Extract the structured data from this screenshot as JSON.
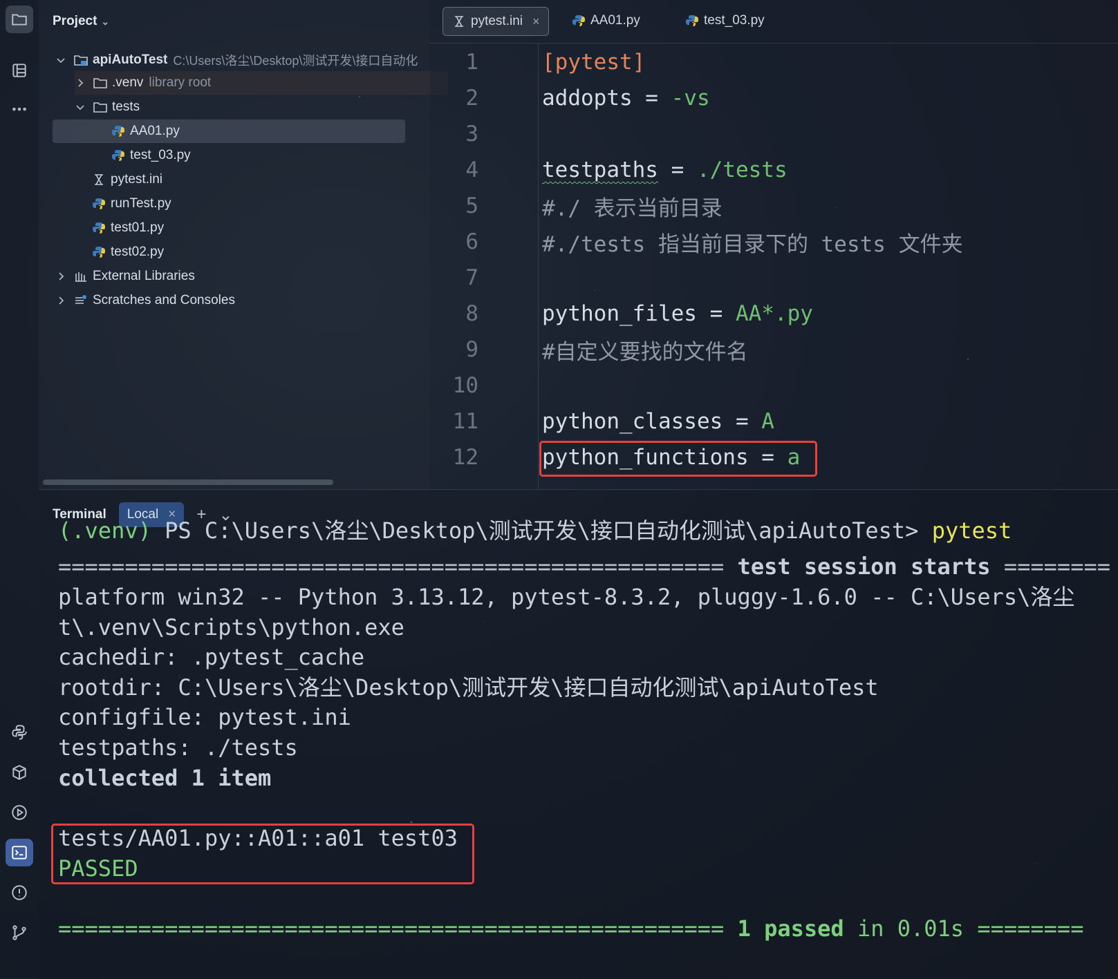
{
  "toolbar": {
    "items": [
      {
        "name": "folder-icon"
      },
      {
        "name": "structure-icon"
      },
      {
        "name": "more-icon"
      },
      {
        "name": "python-console-icon"
      },
      {
        "name": "python-packages-icon"
      },
      {
        "name": "run-icon"
      },
      {
        "name": "terminal-icon"
      },
      {
        "name": "problems-icon"
      },
      {
        "name": "git-icon"
      }
    ]
  },
  "project": {
    "title": "Project",
    "root": {
      "label": "apiAutoTest",
      "path": "C:\\Users\\洛尘\\Desktop\\测试开发\\接口自动化"
    },
    "venv": {
      "label": ".venv",
      "note": "library root"
    },
    "tests_folder": "tests",
    "test_files": [
      "AA01.py",
      "test_03.py"
    ],
    "root_files": [
      "pytest.ini",
      "runTest.py",
      "test01.py",
      "test02.py"
    ],
    "external": "External Libraries",
    "scratches": "Scratches and Consoles"
  },
  "editor": {
    "tabs": [
      {
        "label": "pytest.ini",
        "active": true,
        "close": "×"
      },
      {
        "label": "AA01.py"
      },
      {
        "label": "test_03.py"
      }
    ],
    "line_numbers": [
      "1",
      "2",
      "3",
      "4",
      "5",
      "6",
      "7",
      "8",
      "9",
      "10",
      "11",
      "12"
    ],
    "lines": {
      "l1": "[pytest]",
      "l2_key": "addopts = ",
      "l2_val": "-vs",
      "l4_key": "testpaths",
      "l4_eq": " = ",
      "l4_val": "./tests",
      "l5": "#./ 表示当前目录",
      "l6": "#./tests 指当前目录下的 tests 文件夹",
      "l8_key": "python_files = ",
      "l8_val": "AA*.py",
      "l9": "#自定义要找的文件名",
      "l11_key": "python_classes = ",
      "l11_val": "A",
      "l12_key": "python_functions = ",
      "l12_val": "a"
    }
  },
  "terminal": {
    "title": "Terminal",
    "tab": "Local",
    "tab_close": "×",
    "add": "+",
    "dropdown": "⌄",
    "prompt_venv": "(.venv)",
    "prompt_path": " PS C:\\Users\\洛尘\\Desktop\\测试开发\\接口自动化测试\\apiAutoTest> ",
    "command": "pytest",
    "session_sep_left": "================================================== ",
    "session_text": "test session starts",
    "session_sep_right": " ========",
    "platform": "platform win32 -- Python 3.13.12, pytest-8.3.2, pluggy-1.6.0 -- C:\\Users\\洛尘",
    "platform_cont": "t\\.venv\\Scripts\\python.exe",
    "cachedir": "cachedir: .pytest_cache",
    "rootdir": "rootdir: C:\\Users\\洛尘\\Desktop\\测试开发\\接口自动化测试\\apiAutoTest",
    "configfile": "configfile: pytest.ini",
    "testpaths": "testpaths: ./tests",
    "collected": "collected 1 item",
    "result_line": "tests/AA01.py::A01::a01 test03",
    "passed": "PASSED",
    "summary_sep_left": "================================================== ",
    "summary_text": "1 passed",
    "summary_time": " in 0.01s ",
    "summary_sep_right": "========"
  }
}
